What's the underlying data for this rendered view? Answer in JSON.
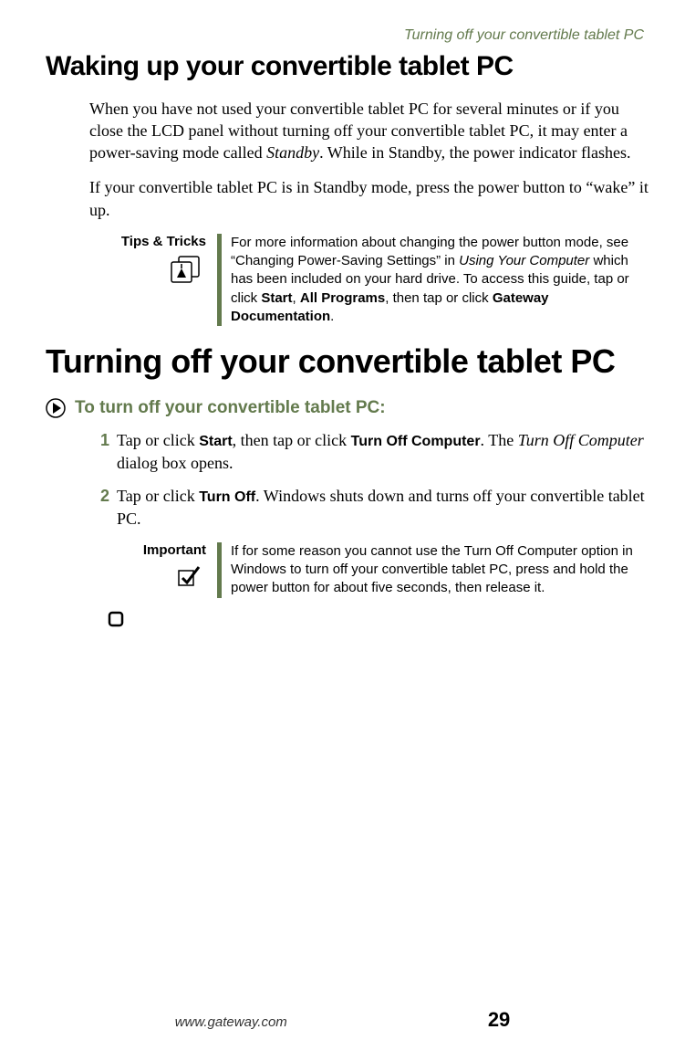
{
  "running_header": "Turning off your convertible tablet PC",
  "section1": {
    "title": "Waking up your convertible tablet PC",
    "para1_a": "When you have not used your convertible tablet PC for several minutes or if you close the LCD panel without turning off your convertible tablet PC, it may enter a power-saving mode called ",
    "para1_b": "Standby",
    "para1_c": ". While in Standby, the power indicator flashes.",
    "para2": "If your convertible tablet PC is in Standby mode, press the power button to “wake” it up."
  },
  "tips": {
    "label": "Tips & Tricks",
    "body_a": "For more information about changing the power button mode, see “Changing Power-Saving Settings” in ",
    "body_b": "Using Your Computer",
    "body_c": " which has been included on your hard drive. To access this guide, tap or click ",
    "body_d": "Start",
    "body_e": ", ",
    "body_f": "All Programs",
    "body_g": ", then tap or click ",
    "body_h": "Gateway Documentation",
    "body_i": "."
  },
  "section2": {
    "title": "Turning off your convertible tablet PC",
    "task_title": "To turn off your convertible tablet PC:",
    "step1": {
      "num": "1",
      "a": "Tap or click ",
      "b": "Start",
      "c": ", then tap or click ",
      "d": "Turn Off Computer",
      "e": ". The ",
      "f": "Turn Off Computer",
      "g": " dialog box opens."
    },
    "step2": {
      "num": "2",
      "a": "Tap or click ",
      "b": "Turn Off",
      "c": ". Windows shuts down and turns off your convertible tablet PC."
    }
  },
  "important": {
    "label": "Important",
    "body": "If for some reason you cannot use the Turn Off Computer option in Windows to turn off your convertible tablet PC, press and hold the power button for about five seconds, then release it."
  },
  "footer": {
    "url": "www.gateway.com",
    "page": "29"
  }
}
